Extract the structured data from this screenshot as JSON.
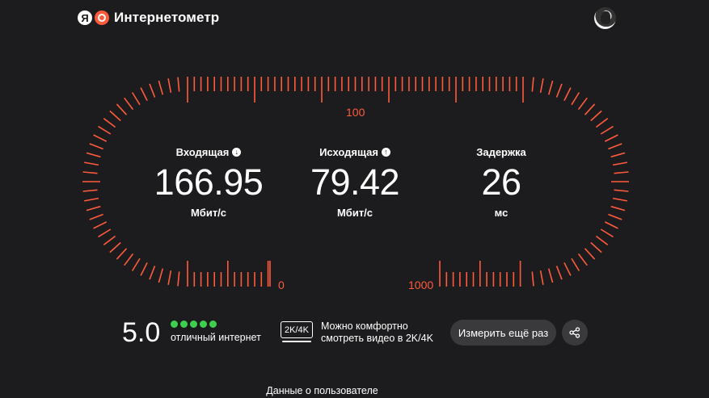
{
  "app": {
    "title": "Интернетометр",
    "logo_letter": "Я"
  },
  "scale": {
    "labels": {
      "top": "100",
      "bottom_left": "0",
      "bottom_right": "1000"
    },
    "color": "#ff5a3c"
  },
  "metrics": {
    "download": {
      "label": "Входящая",
      "value": "166.95",
      "unit": "Мбит/с",
      "icon": "arrow-down-icon"
    },
    "upload": {
      "label": "Исходящая",
      "value": "79.42",
      "unit": "Мбит/с",
      "icon": "arrow-up-icon"
    },
    "latency": {
      "label": "Задержка",
      "value": "26",
      "unit": "мс"
    }
  },
  "rating": {
    "score": "5.0",
    "dots_filled": 5,
    "dots_total": 5,
    "text": "отличный интернет",
    "color": "#3fcf4e"
  },
  "video": {
    "badge": "2K/4K",
    "line1": "Можно комфортно",
    "line2": "смотреть видео в 2K/4K"
  },
  "actions": {
    "retest_label": "Измерить ещё раз",
    "share_icon": "share-icon"
  },
  "footer": {
    "link": "Данные о пользователе"
  }
}
